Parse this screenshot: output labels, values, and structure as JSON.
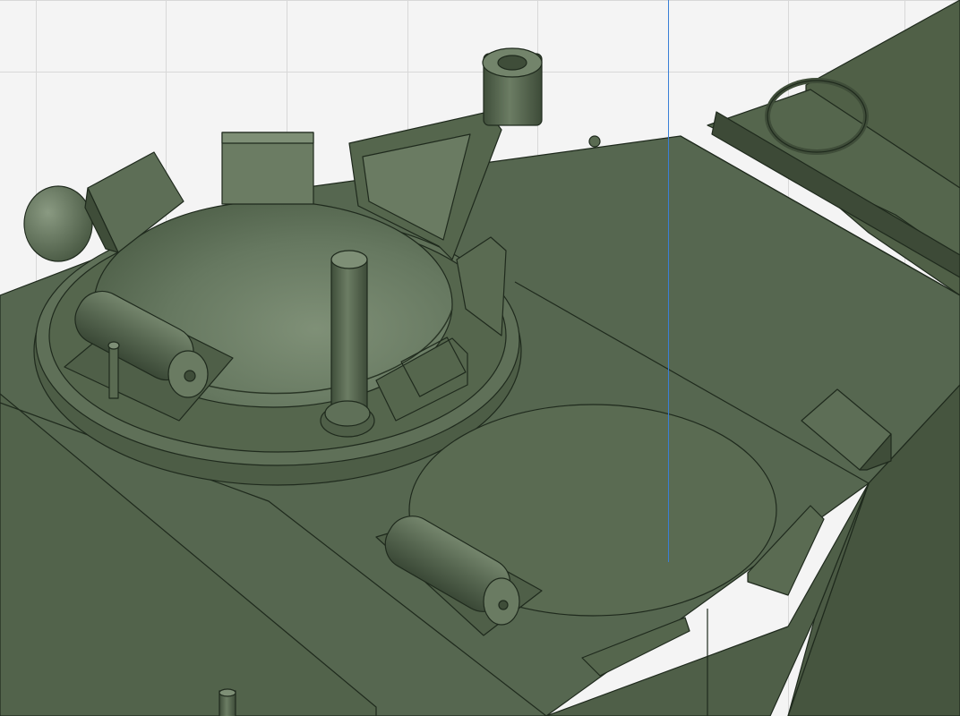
{
  "viewport": {
    "background": "#f4f4f4",
    "grid_color": "#d8d8d8",
    "axis_color": "#3a7fd6"
  },
  "model": {
    "hull_color": "#5a6b52",
    "edge_color": "#1f2a1d",
    "parts": [
      "turret-hull",
      "commander-hatch",
      "driver-hatch",
      "periscope-mount",
      "hatch-hinges",
      "lifting-eyes",
      "vision-blocks"
    ]
  }
}
